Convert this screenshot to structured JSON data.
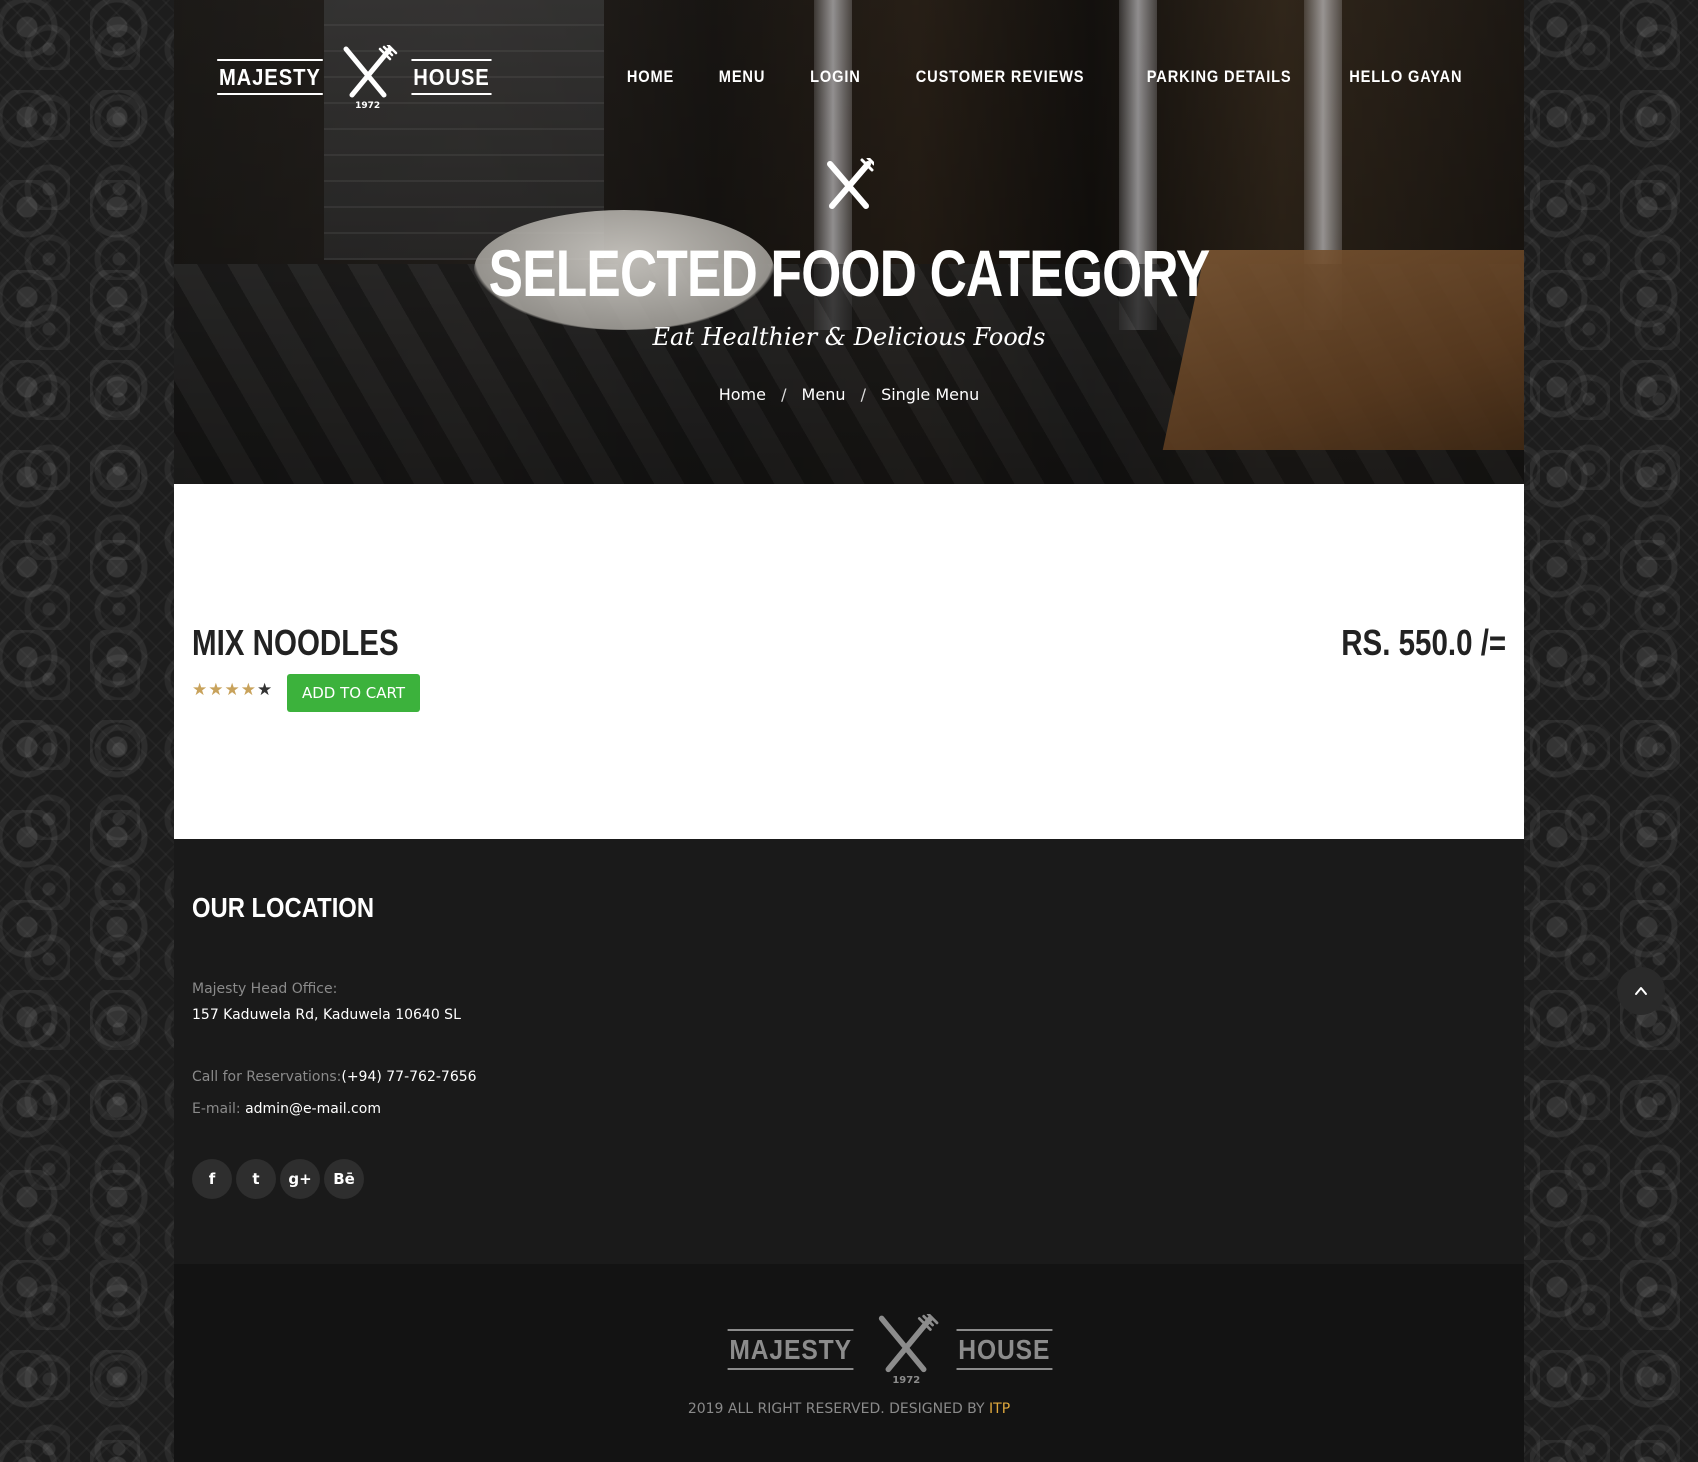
{
  "brand": {
    "left_word": "MAJESTY",
    "right_word": "HOUSE",
    "year": "1972"
  },
  "nav": [
    {
      "label": "HOME"
    },
    {
      "label": "MENU"
    },
    {
      "label": "LOGIN"
    },
    {
      "label": "CUSTOMER REVIEWS"
    },
    {
      "label": "PARKING DETAILS"
    },
    {
      "label": "HELLO GAYAN"
    }
  ],
  "hero": {
    "icon": "fork-knife-icon",
    "title": "SELECTED FOOD CATEGORY",
    "subtitle": "Eat Healthier & Delicious Foods",
    "breadcrumb": [
      "Home",
      "Menu",
      "Single Menu"
    ],
    "breadcrumb_separator": "/"
  },
  "item": {
    "name": "MIX NOODLES",
    "price": "RS. 550.0 /=",
    "rating": 4,
    "rating_max": 5,
    "cart_label": "ADD TO CART",
    "cart_color": "#3cb23c",
    "star_color": "#c8a25b"
  },
  "location": {
    "title": "OUR LOCATION",
    "office_label": "Majesty Head Office:",
    "address": "157 Kaduwela Rd, Kaduwela 10640 SL",
    "phone_label": "Call for Reservations:",
    "phone": "(+94) 77-762-7656",
    "email_label": "E-mail:",
    "email": "admin@e-mail.com",
    "social": [
      {
        "icon": "facebook-icon",
        "glyph": "f"
      },
      {
        "icon": "twitter-icon",
        "glyph": "t"
      },
      {
        "icon": "google-plus-icon",
        "glyph": "g+"
      },
      {
        "icon": "behance-icon",
        "glyph": "Bē"
      }
    ]
  },
  "footer": {
    "copyright_prefix": "2019 ALL RIGHT RESERVED. DESIGNED BY ",
    "designer": "ITP",
    "designer_color": "#e0a93d"
  },
  "scroll_top": {
    "icon": "chevron-up-icon"
  }
}
